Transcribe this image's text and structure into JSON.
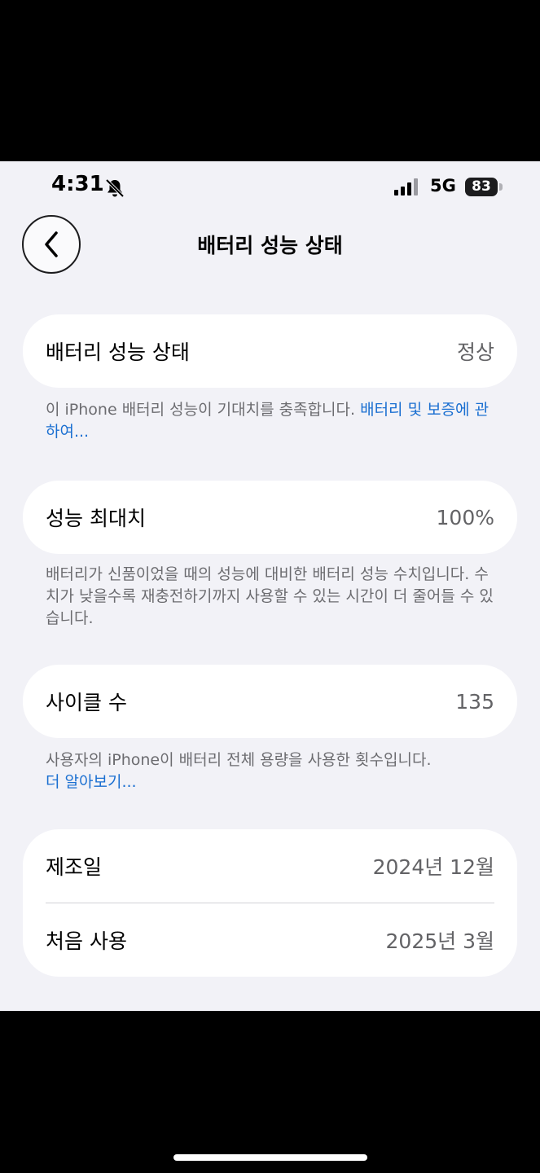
{
  "status_bar": {
    "time": "4:31",
    "network": "5G",
    "battery_level": "83",
    "silent_icon": "bell-slash-icon",
    "signal_icon": "cellular-signal-icon"
  },
  "nav": {
    "back_icon": "chevron-left-icon",
    "title": "배터리 성능 상태"
  },
  "sections": {
    "health": {
      "label": "배터리 성능 상태",
      "value": "정상",
      "footnote_text": "이 iPhone 배터리 성능이 기대치를 충족합니다. ",
      "footnote_link": "배터리 및 보증에 관하여..."
    },
    "max_capacity": {
      "label": "성능 최대치",
      "value": "100%",
      "footnote_text": "배터리가 신품이었을 때의 성능에 대비한 배터리 성능 수치입니다. 수치가 낮을수록 재충전하기까지 사용할 수 있는 시간이 더 줄어들 수 있습니다."
    },
    "cycle_count": {
      "label": "사이클 수",
      "value": "135",
      "footnote_text": "사용자의 iPhone이 배터리 전체 용량을 사용한 횟수입니다.",
      "footnote_link": "더 알아보기..."
    },
    "dates": {
      "manufacture_label": "제조일",
      "manufacture_value": "2024년 12월",
      "first_use_label": "처음 사용",
      "first_use_value": "2025년 3월"
    }
  },
  "colors": {
    "background": "#f2f2f7",
    "card": "#ffffff",
    "link": "#1a6fd1",
    "secondary_text": "#6c6c70"
  }
}
